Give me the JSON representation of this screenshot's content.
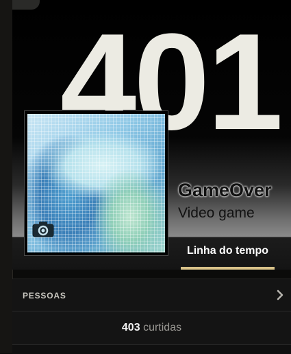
{
  "cover": {
    "big_text": "401"
  },
  "profile": {
    "name": "GameOver",
    "category": "Video game",
    "camera_icon": "camera-icon"
  },
  "tabs": {
    "timeline": "Linha do tempo"
  },
  "people": {
    "title": "PESSOAS",
    "chevron_icon": "chevron-right-icon",
    "likes_count": "403",
    "likes_label": "curtidas"
  },
  "colors": {
    "tab_underline": "#d9c38a",
    "big_text": "#ecebe3",
    "background": "#0b0b0a"
  }
}
